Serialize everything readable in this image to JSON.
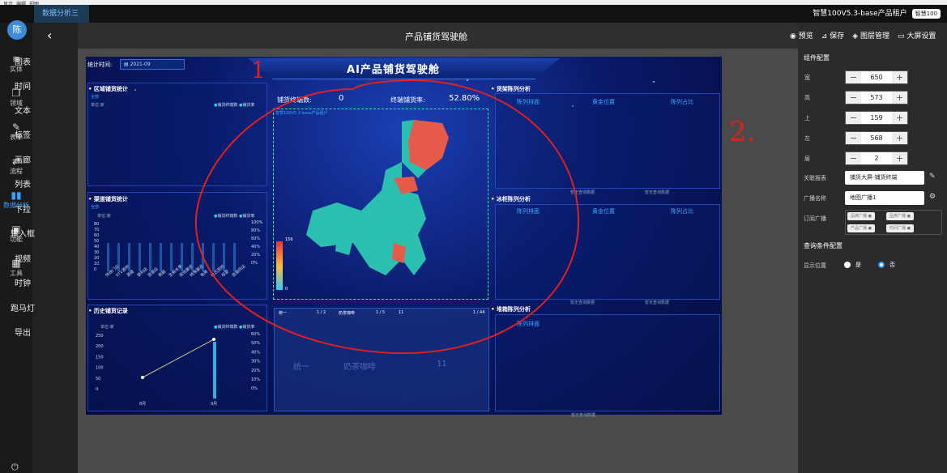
{
  "topbar": {
    "menu": [
      "显示",
      "编辑",
      "视图"
    ]
  },
  "app_tab": "数据分析三",
  "tenant": {
    "name": "智慧100V5.3-base产品租户",
    "badge": "智慧100"
  },
  "user_avatar": "陈",
  "left_nav": [
    {
      "label": "实体",
      "icon": "database-icon"
    },
    {
      "label": "领域",
      "icon": "cube-icon"
    },
    {
      "label": "表单",
      "icon": "form-icon"
    },
    {
      "label": "流程",
      "icon": "flow-icon"
    },
    {
      "label": "数据分析",
      "icon": "chart-icon"
    },
    {
      "label": "功能",
      "icon": "function-icon"
    },
    {
      "label": "工具",
      "icon": "tools-icon"
    }
  ],
  "components": [
    "图表",
    "时间",
    "文本",
    "标签",
    "画廊",
    "列表",
    "下拉",
    "输入框",
    "视频",
    "时钟",
    "跑马灯",
    "导出"
  ],
  "page_title": "产品铺货驾驶舱",
  "toolbar": {
    "preview": "预览",
    "save": "保存",
    "layers": "图层管理",
    "screen_settings": "大屏设置"
  },
  "screen": {
    "title": "AI产品铺货驾驶舱",
    "stat_label": "统计时间:",
    "stat_date": "2021-09",
    "panel_region": {
      "title": "区域铺货统计",
      "filter": "全部",
      "unit": "单位:家",
      "legend": [
        "铺货终端数",
        "铺货率"
      ]
    },
    "panel_channel": {
      "title": "渠道铺货统计",
      "filter": "全部",
      "unit": "单位:家",
      "legend": [
        "铺货终端数",
        "铺货率"
      ],
      "categories": [
        "传统门店",
        "KTV酒吧",
        "酒楼",
        "便利店",
        "连锁店",
        "商超",
        "生鲜水果",
        "其他渠道",
        "特殊渠道",
        "电商",
        "社区团购",
        "母婴",
        "连锁药店"
      ],
      "y_ticks": [
        "80",
        "70",
        "60",
        "50",
        "40",
        "30",
        "20",
        "10",
        "0"
      ],
      "y2_ticks": [
        "100%",
        "80%",
        "60%",
        "40%",
        "20%",
        "0%"
      ]
    },
    "panel_history": {
      "title": "历史铺货记录",
      "unit": "单位:家",
      "legend": [
        "铺货终端数",
        "铺货率"
      ],
      "y_ticks": [
        "250",
        "200",
        "150",
        "100",
        "50",
        "0"
      ],
      "y2_ticks": [
        "60%",
        "50%",
        "40%",
        "30%",
        "20%",
        "10%",
        "0%"
      ],
      "x": [
        "8月",
        "9月"
      ]
    },
    "kpi": {
      "label1": "铺货终端数:",
      "value1": "0",
      "label2": "终端铺货率:",
      "value2": "52.80%"
    },
    "map_tag": "智慧100V5.3-base产品租户",
    "map_scale": {
      "max": "156",
      "min": "0"
    },
    "panel_shelf": {
      "title": "货架陈列分析",
      "tabs": [
        "陈列排面",
        "黄金位置",
        "陈列占比"
      ],
      "empty": "暂无查询数据"
    },
    "panel_freezer": {
      "title": "冰柜陈列分析",
      "tabs": [
        "陈列排面",
        "黄金位置",
        "陈列占比"
      ],
      "empty": "暂无查询数据"
    },
    "panel_pile": {
      "title": "堆箱陈列分析",
      "tabs": [
        "陈列排面"
      ],
      "empty": "暂无查询数据"
    },
    "table": {
      "cols": [
        {
          "h": "统一",
          "p": "1 / 2",
          "v": "统一"
        },
        {
          "h": "奶茶咖啡",
          "p": "1 / 5",
          "v": "奶茶咖啡"
        },
        {
          "h": "11",
          "p": "1 / 44",
          "v": "11"
        }
      ]
    }
  },
  "right_panel": {
    "heading": "组件配置",
    "fields": [
      {
        "label": "宽",
        "value": "650"
      },
      {
        "label": "高",
        "value": "573"
      },
      {
        "label": "上",
        "value": "159"
      },
      {
        "label": "左",
        "value": "568"
      },
      {
        "label": "层",
        "value": "2"
      }
    ],
    "report_label": "关联报表",
    "report_value": "铺货大屏-铺货终端",
    "broadcast_label": "广播名称",
    "broadcast_value": "地图广播1",
    "subscribe_label": "订阅广播",
    "chips": [
      "品牌广播",
      "品类广播",
      "产品广播",
      "时间广播"
    ],
    "query_heading": "查询条件配置",
    "display_label": "显示位置",
    "yes": "是",
    "no": "否"
  },
  "annotations": [
    "1",
    "2."
  ]
}
